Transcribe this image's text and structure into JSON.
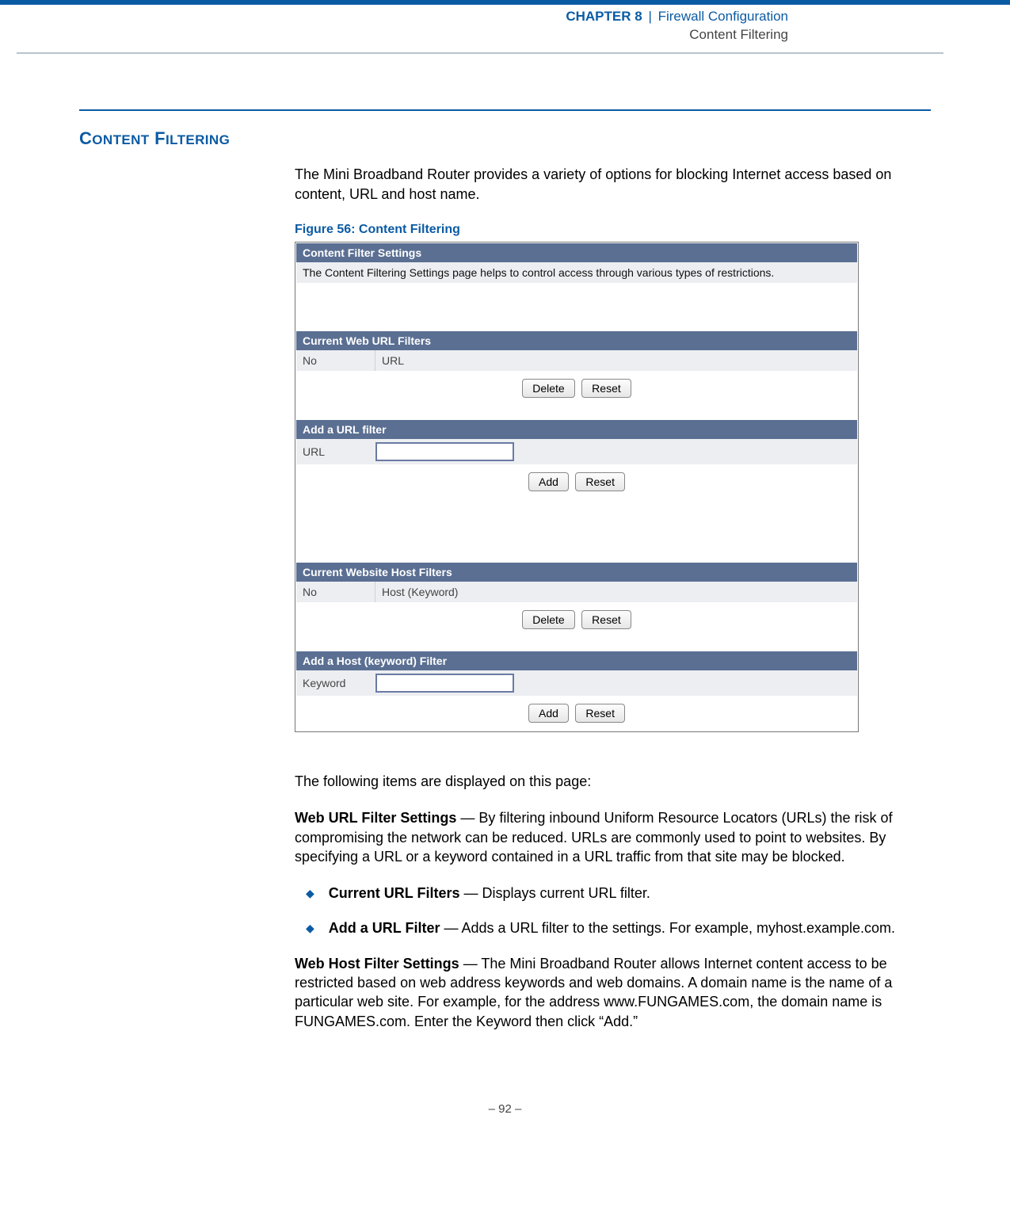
{
  "header": {
    "chapter_small": "C",
    "chapter_rest": "HAPTER",
    "chapter_num": " 8",
    "sep": "|",
    "config": "Firewall Configuration",
    "subtitle": "Content Filtering"
  },
  "section": {
    "title_first": "C",
    "title_rest_1": "ONTENT",
    "title_space": " F",
    "title_rest_2": "ILTERING"
  },
  "intro": "The Mini Broadband Router provides a variety of options for blocking Internet access based on content, URL and host name.",
  "figure_caption": "Figure 56:  Content Filtering",
  "screenshot": {
    "panel_title": "Content Filter Settings",
    "panel_desc": "The Content Filtering Settings page helps to control access through various types of restrictions.",
    "url_filters_title": "Current Web URL Filters",
    "col_no": "No",
    "col_url": "URL",
    "btn_delete": "Delete",
    "btn_reset": "Reset",
    "add_url_title": "Add a URL filter",
    "form_url_label": "URL",
    "btn_add": "Add",
    "host_filters_title": "Current Website Host Filters",
    "col_host": "Host (Keyword)",
    "add_host_title": "Add a Host (keyword) Filter",
    "form_keyword_label": "Keyword"
  },
  "after_text": "The following items are displayed on this page:",
  "para1_lead": "Web URL Filter Settings",
  "para1_body": " — By filtering inbound Uniform Resource Locators (URLs) the risk of compromising the network can be reduced. URLs are commonly used to point to websites. By specifying a URL or a keyword contained in a URL traffic from that site may be blocked.",
  "bullet1_lead": "Current URL Filters",
  "bullet1_body": " — Displays current URL filter.",
  "bullet2_lead": "Add a URL Filter",
  "bullet2_body": " — Adds a URL filter to the settings. For example, myhost.example.com.",
  "para2_lead": "Web Host Filter Settings",
  "para2_body": " — The Mini Broadband Router allows Internet content access to be restricted based on web address keywords and web domains. A domain name is the name of a particular web site. For example, for the address www.FUNGAMES.com, the domain name is FUNGAMES.com. Enter the Keyword then click “Add.”",
  "footer": "–  92  –"
}
